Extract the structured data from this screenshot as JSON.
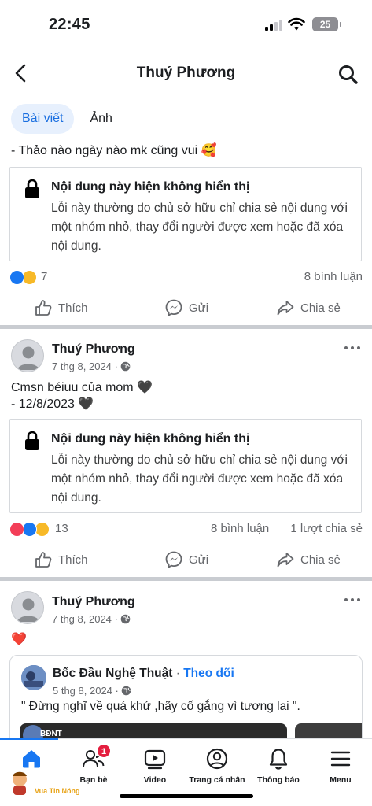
{
  "status_bar": {
    "time": "22:45",
    "battery": "25"
  },
  "header": {
    "title": "Thuý Phương"
  },
  "tabs": [
    {
      "label": "Bài viết",
      "active": true
    },
    {
      "label": "Ảnh",
      "active": false
    }
  ],
  "post1": {
    "text": "- Thảo nào ngày nào mk cũng vui 🥰",
    "unavailable": {
      "title": "Nội dung này hiện không hiển thị",
      "body": "Lỗi này thường do chủ sở hữu chỉ chia sẻ nội dung với một nhóm nhỏ, thay đổi người được xem hoặc đã xóa nội dung."
    },
    "reaction_count": "7",
    "comments": "8 bình luận"
  },
  "post2": {
    "author": "Thuý Phương",
    "date": "7 thg 8, 2024 ·",
    "text_line1": "Cmsn béiuu của mom 🖤",
    "text_line2": "- 12/8/2023 🖤",
    "unavailable": {
      "title": "Nội dung này hiện không hiển thị",
      "body": "Lỗi này thường do chủ sở hữu chỉ chia sẻ nội dung với một nhóm nhỏ, thay đổi người được xem hoặc đã xóa nội dung."
    },
    "reaction_count": "13",
    "comments": "8 bình luận",
    "shares": "1 lượt chia sẻ"
  },
  "post3": {
    "author": "Thuý Phương",
    "date": "7 thg 8, 2024 ·",
    "text": "❤️",
    "shared": {
      "page_name": "Bốc Đầu Nghệ Thuật",
      "separator": "·",
      "follow": "Theo dõi",
      "date": "5 thg 8, 2024 ·",
      "text": "\" Đừng nghĩ về quá khứ ,hãy cố gắng vì tương lai \".",
      "thumb_label": "BĐNT"
    }
  },
  "actions": {
    "like": "Thích",
    "send": "Gửi",
    "share": "Chia sẻ"
  },
  "bottom_nav": {
    "items": [
      {
        "label": "",
        "icon": "home-icon"
      },
      {
        "label": "Bạn bè",
        "icon": "friends-icon",
        "badge": "1"
      },
      {
        "label": "Video",
        "icon": "video-icon"
      },
      {
        "label": "Trang cá nhân",
        "icon": "profile-icon"
      },
      {
        "label": "Thông báo",
        "icon": "bell-icon"
      },
      {
        "label": "Menu",
        "icon": "menu-icon"
      }
    ]
  },
  "watermark": {
    "text": "Vua Tin Nóng"
  },
  "colors": {
    "accent": "#1877f2",
    "tab_active_bg": "#e7f0fd",
    "separator": "#c9ccd1",
    "badge": "#e41e3f"
  }
}
